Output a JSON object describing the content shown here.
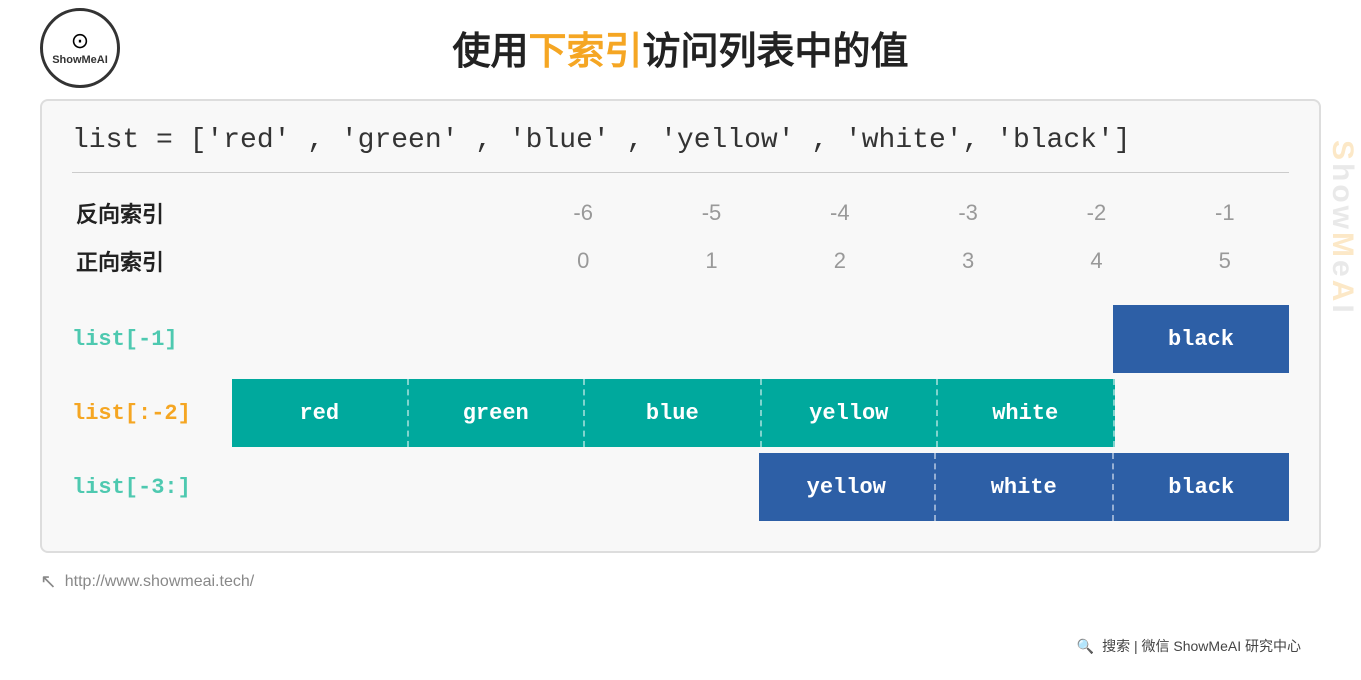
{
  "page": {
    "background": "#ffffff"
  },
  "header": {
    "logo_text": "ShowMeAI",
    "logo_icon": "⊙",
    "title_part1": "使用",
    "title_highlight": "下索引",
    "title_part2": "访问列表中的值"
  },
  "list_declaration": "list = ['red' , 'green' , 'blue' , 'yellow' , 'white', 'black']",
  "index_labels": {
    "reverse": "反向索引",
    "forward": "正向索引"
  },
  "list_items": [
    "red",
    "green",
    "blue",
    "yellow",
    "white",
    "black"
  ],
  "reverse_indices": [
    "-6",
    "-5",
    "-4",
    "-3",
    "-2",
    "-1"
  ],
  "forward_indices": [
    "0",
    "1",
    "2",
    "3",
    "4",
    "5"
  ],
  "examples": [
    {
      "label": "list[-1]",
      "label_color": "blue",
      "items": [
        "",
        "",
        "",
        "",
        "",
        "black"
      ],
      "highlight_indices": [
        5
      ],
      "highlight_color": "dark-blue"
    },
    {
      "label": "list[:-2]",
      "label_color": "orange",
      "items": [
        "red",
        "green",
        "blue",
        "yellow",
        "white",
        ""
      ],
      "highlight_indices": [
        0,
        1,
        2,
        3,
        4
      ],
      "highlight_color": "teal"
    },
    {
      "label": "list[-3:]",
      "label_color": "cyan",
      "items": [
        "",
        "",
        "",
        "yellow",
        "white",
        "black"
      ],
      "highlight_indices": [
        3,
        4,
        5
      ],
      "highlight_color": "dark-blue"
    }
  ],
  "footer": {
    "url": "http://www.showmeai.tech/"
  },
  "watermark": {
    "text": "ShowMeAI",
    "bottom_text": "搜索 | 微信  ShowMeAI 研究中心"
  }
}
